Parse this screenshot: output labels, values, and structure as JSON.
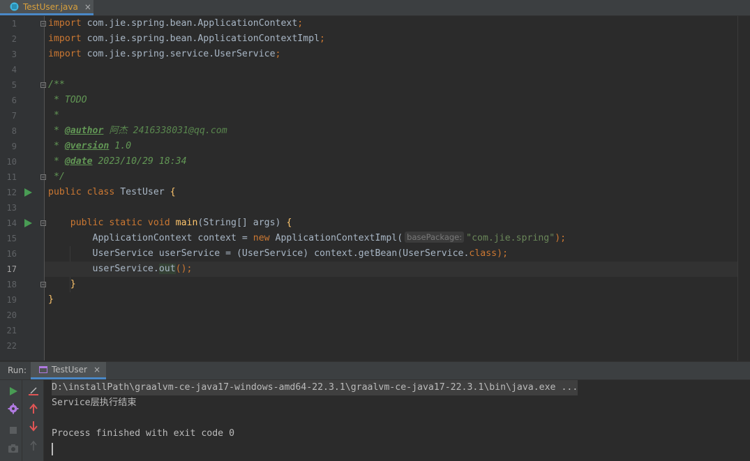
{
  "editor_tab": {
    "filename": "TestUser.java",
    "close": "×"
  },
  "code": {
    "line_numbers": [
      "1",
      "2",
      "3",
      "4",
      "5",
      "6",
      "7",
      "8",
      "9",
      "10",
      "11",
      "12",
      "13",
      "14",
      "15",
      "16",
      "17",
      "18",
      "19",
      "20",
      "21",
      "22"
    ],
    "l1": {
      "kw": "import",
      "rest": " com.jie.spring.bean.ApplicationContext",
      "semi": ";"
    },
    "l2": {
      "kw": "import",
      "rest": " com.jie.spring.bean.ApplicationContextImpl",
      "semi": ";"
    },
    "l3": {
      "kw": "import",
      "rest": " com.jie.spring.service.UserService",
      "semi": ";"
    },
    "l5": "/**",
    "l6": " * TODO",
    "l7": " *",
    "l8": {
      "star": " * ",
      "tag": "@author",
      "text": " 阿杰 2416338031@qq.com"
    },
    "l9": {
      "star": " * ",
      "tag": "@version",
      "text": " 1.0"
    },
    "l10": {
      "star": " * ",
      "tag": "@date",
      "text": " 2023/10/29 18:34"
    },
    "l11": " */",
    "l12": {
      "kw": "public class",
      "name": " TestUser ",
      "brace": "{"
    },
    "l14": {
      "kw": "public static void",
      "sp": " ",
      "fn": "main",
      "params": "(String[] args) ",
      "brace": "{"
    },
    "l15": {
      "decl": "ApplicationContext context = ",
      "kw": "new",
      "ctor": " ApplicationContextImpl(",
      "hint": "basePackage:",
      "str": "\"com.jie.spring\"",
      "end": ");"
    },
    "l16": {
      "decl": "UserService userService = (UserService) context.getBean(UserService.",
      "kw": "class",
      "end": ");"
    },
    "l17": {
      "obj": "userService.",
      "method": "out",
      "end": "();"
    },
    "l18": "}",
    "l19": "}"
  },
  "run_panel": {
    "label": "Run:",
    "tab_label": "TestUser",
    "tab_close": "×",
    "console": [
      "D:\\installPath\\graalvm-ce-java17-windows-amd64-22.3.1\\graalvm-ce-java17-22.3.1\\bin\\java.exe ...",
      "Service层执行结束",
      "",
      "Process finished with exit code 0"
    ]
  },
  "colors": {
    "keyword": "#cc7832",
    "string": "#6a8759",
    "doc_comment": "#629755",
    "function": "#ffc66d",
    "text": "#a9b7c6",
    "run_green": "#499c54",
    "accent_blue": "#4a88c7"
  },
  "icons": [
    "java-class-icon",
    "run-gutter-icon",
    "fold-icon",
    "rerun-icon",
    "settings-icon",
    "stop-icon",
    "camera-icon",
    "clear-icon",
    "scroll-up-icon",
    "scroll-down-icon",
    "scroll-top-icon",
    "run-config-icon"
  ]
}
